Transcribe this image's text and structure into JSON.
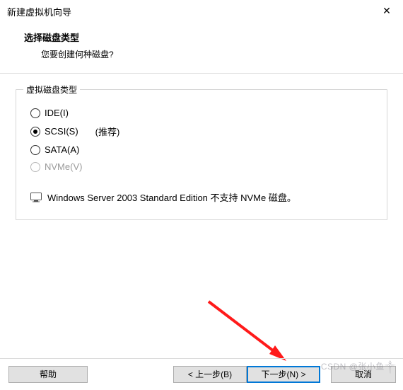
{
  "window": {
    "title": "新建虚拟机向导"
  },
  "header": {
    "heading": "选择磁盘类型",
    "sub": "您要创建何种磁盘?"
  },
  "group": {
    "legend": "虚拟磁盘类型",
    "options": {
      "ide": {
        "label": "IDE(I)"
      },
      "scsi": {
        "label": "SCSI(S)",
        "recommend": "(推荐)"
      },
      "sata": {
        "label": "SATA(A)"
      },
      "nvme": {
        "label": "NVMe(V)"
      }
    },
    "info": "Windows Server 2003 Standard Edition 不支持 NVMe 磁盘。"
  },
  "buttons": {
    "help": "帮助",
    "prev": "< 上一步(B)",
    "next": "下一步(N) >",
    "cancel": "取消"
  },
  "watermark": "CSDN @张小鱼༒"
}
